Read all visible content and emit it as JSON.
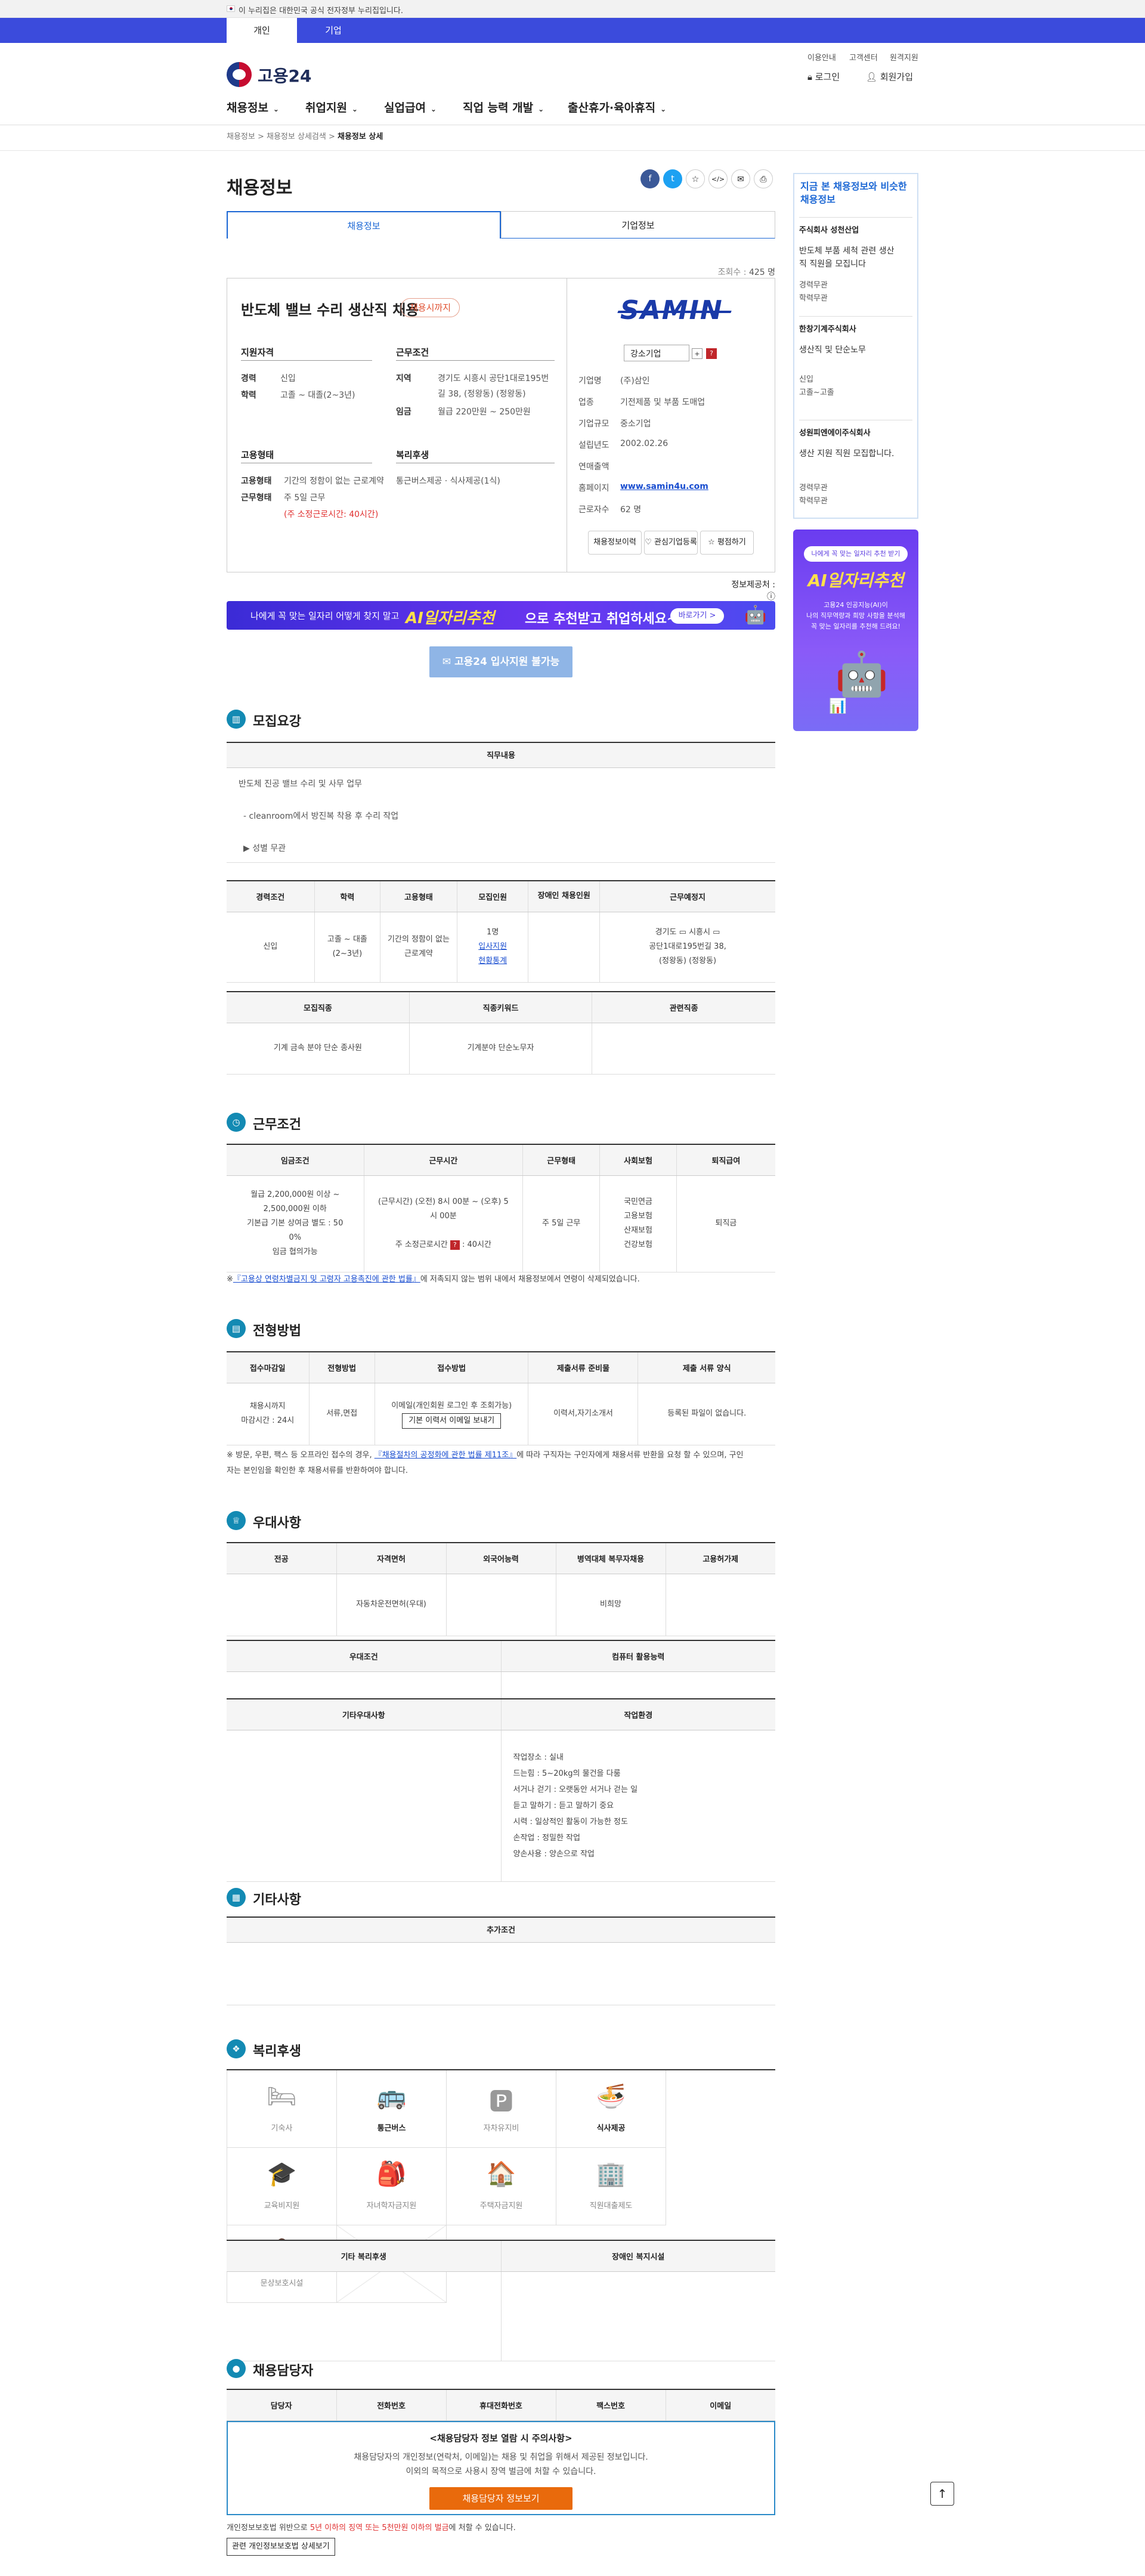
{
  "gov_banner": {
    "text": "이 누리집은 대한민국 공식 전자정부 누리집입니다."
  },
  "top_tabs": [
    "개인",
    "기업"
  ],
  "utility": [
    "이용안내",
    "고객센터",
    "원격지원"
  ],
  "logo": {
    "text": "고용24"
  },
  "auth": {
    "login": "로그인",
    "signup": "회원가입"
  },
  "gnb": [
    "채용정보",
    "취업지원",
    "실업급여",
    "직업 능력 개발",
    "출산휴가·육아휴직"
  ],
  "breadcrumb": {
    "items": [
      "채용정보",
      "채용정보 상세검색"
    ],
    "current": "채용정보 상세"
  },
  "page_title": "채용정보",
  "share": {
    "f": "f",
    "t": "t",
    "star": "☆",
    "code": "</>",
    "mail": "✉",
    "print": "⎙"
  },
  "content_tabs": [
    "채용정보",
    "기업정보"
  ],
  "views": {
    "label": "조회수 :",
    "value": "425 명"
  },
  "job": {
    "title": "반도체 밸브 수리 생산직 채용",
    "deadline": "채용시까지",
    "qual_head": "지원자격",
    "career_k": "경력",
    "career_v": "신입",
    "edu_k": "학력",
    "edu_v": "고졸 ~ 대졸(2~3년)",
    "cond_head": "근무조건",
    "region_k": "지역",
    "region_v1": "경기도 시흥시 공단1대로195번",
    "region_v2": "길 38, (정왕동) (정왕동)",
    "wage_k": "임금",
    "wage_v": "월급 220만원 ~ 250만원",
    "emp_head": "고용형태",
    "emptype_k": "고용형태",
    "emptype_v": "기간의 정함이 없는 근로계약",
    "worktype_k": "근무형태",
    "worktype_v": "주 5일 근무",
    "hours_v": "(주 소정근로시간: 40시간)",
    "welfare_head": "복리후생",
    "welfare_v": "통근버스제공 · 식사제공(1식)"
  },
  "company": {
    "logo": "SAMIN",
    "category": "강소기업",
    "plus": "+",
    "q": "?",
    "rows": [
      {
        "k": "기업명",
        "v": "(주)삼인"
      },
      {
        "k": "업종",
        "v": "기전제품 및 부품 도매업"
      },
      {
        "k": "기업규모",
        "v": "중소기업"
      },
      {
        "k": "설립년도",
        "v": "2002.02.26"
      },
      {
        "k": "연매출액",
        "v": ""
      },
      {
        "k": "홈페이지",
        "v": "www.samin4u.com"
      },
      {
        "k": "근로자수",
        "v": "62 명"
      }
    ],
    "buttons": [
      "채용정보이력",
      "관심기업등록",
      "평점하기"
    ]
  },
  "info_public": {
    "label": "정보제공처 :",
    "value": "ⓘ"
  },
  "ai_banner": {
    "t1": "나에게 꼭 맞는 일자리 어떻게 찾지 말고",
    "t2": "AI일자리추천",
    "t3": "으로 추천받고 취업하세요~",
    "btn": "바로가기 >"
  },
  "apply_btn": "고용24 입사지원 불가능",
  "sections": {
    "recruit": "모집요강",
    "condition": "근무조건",
    "selection": "전형방법",
    "preference": "우대사항",
    "etc": "기타사항",
    "welfare": "복리후생",
    "contact": "채용담당자"
  },
  "recruit": {
    "duty_head": "직무내용",
    "duty_lines": [
      "반도체 진공 밸브 수리 및 사무 업무",
      "- cleanroom에서 방진복 착용 후 수리 작업",
      "▶ 성별 무관"
    ],
    "table1_headers": [
      "경력조건",
      "학력",
      "고용형태",
      "모집인원",
      "장애인 채용인원",
      "근무예정지"
    ],
    "table1_row": {
      "career": "신입",
      "edu1": "고졸 ~ 대졸",
      "edu2": "(2~3년)",
      "emp1": "기간의 정함이 없는",
      "emp2": "근로계약",
      "count": "1명",
      "link1": "입사지원",
      "link2": "현황통계",
      "disabled": "",
      "loc1": "경기도",
      "loc2": "시흥시",
      "loc3": "공단1대로195번길 38,",
      "loc4": "(정왕동) (정왕동)"
    },
    "table2_headers": [
      "모집직종",
      "직종키워드",
      "관련직종"
    ],
    "table2_row": [
      "기계 금속 분야 단순 종사원",
      "기계분야 단순노무자",
      ""
    ]
  },
  "condition": {
    "headers": [
      "임금조건",
      "근무시간",
      "근무형태",
      "사회보험",
      "퇴직급여"
    ],
    "wage": [
      "월급 2,200,000원 이상 ~",
      "2,500,000원 이하",
      "기본급 기본 상여금 별도 : 50",
      "0%",
      "임금 협의가능"
    ],
    "time": [
      "(근무시간) (오전) 8시 00분 ~ (오후) 5",
      "시 00분",
      "주 소정근로시간",
      "40시간"
    ],
    "worktype": "주 5일 근무",
    "insurance": [
      "국민연금",
      "고용보험",
      "산재보험",
      "건강보험"
    ],
    "retire": "퇴직금",
    "note_pre": "※",
    "note_link": "『고용상 연령차별금지 및 고령자 고용촉진에 관한 법률』",
    "note_post": "에 저촉되지 않는 범위 내에서 채용정보에서 연령이 삭제되었습니다."
  },
  "selection": {
    "headers": [
      "접수마감일",
      "전형방법",
      "접수방법",
      "제출서류 준비물",
      "제출 서류 양식"
    ],
    "deadline1": "채용시까지",
    "deadline2": "마감시간 : 24시",
    "method": "서류,면접",
    "recv": "이메일(개인회원 로그인 후 조회가능)",
    "recv_btn": "기본 이력서 이메일 보내기",
    "docs": "이력서,자기소개서",
    "form": "등록된 파일이 없습니다.",
    "note_pre": "※ 방문, 우편, 팩스 등 오프라인 접수의 경우,",
    "note_link": "『채용절차의 공정화에 관한 법률 제11조』",
    "note_mid": "에 따라 구직자는 구인자에게 채용서류 반환을 요청 할 수 있으며, 구인",
    "note_2": "자는 본인임을 확인한 후 채용서류를 반환하여야 합니다."
  },
  "preference": {
    "headers": [
      "전공",
      "자격면허",
      "외국어능력",
      "병역대체 복무자채용",
      "고용허가제"
    ],
    "row": [
      "",
      "자동차운전면허(우대)",
      "",
      "비희망",
      ""
    ],
    "pref_head": "우대조건",
    "computer_head": "컴퓨터 활용능력",
    "other_head": "기타우대사항",
    "env_head": "작업환경",
    "env": [
      "작업장소 : 실내",
      "드는힘 : 5~20kg의 물건을 다룸",
      "서거나 걷기 : 오랫동안 서거나 걷는 일",
      "듣고 말하기 : 듣고 말하기 중요",
      "시력 : 일상적인 활동이 가능한 정도",
      "손작업 : 정밀한 작업",
      "양손사용 : 양손으로 작업"
    ]
  },
  "etc": {
    "head": "추가조건"
  },
  "welfare": {
    "items": [
      {
        "icon": "🛏",
        "label": "기숙사",
        "on": false,
        "name": "dormitory-icon"
      },
      {
        "icon": "🚌",
        "label": "통근버스",
        "on": true,
        "name": "bus-icon"
      },
      {
        "icon": "🅿",
        "label": "자차유지비",
        "on": false,
        "name": "car-icon"
      },
      {
        "icon": "🍜",
        "label": "식사제공",
        "on": true,
        "name": "meal-icon"
      },
      {
        "icon": "🎓",
        "label": "교육비지원",
        "on": false,
        "name": "education-icon"
      },
      {
        "icon": "🎒",
        "label": "자녀학자금지원",
        "on": false,
        "name": "child-education-icon"
      },
      {
        "icon": "🏠",
        "label": "주택자금지원",
        "on": false,
        "name": "housing-icon"
      },
      {
        "icon": "🏢",
        "label": "직원대출제도",
        "on": false,
        "name": "loan-icon"
      },
      {
        "icon": "👶",
        "label": "문상보호시설",
        "on": false,
        "name": "childcare-icon"
      },
      {
        "icon": "",
        "label": "",
        "on": false,
        "name": "empty-icon"
      }
    ],
    "other_head": "기타 복리후생",
    "disabled_head": "장애인 복지시설"
  },
  "contact": {
    "headers": [
      "담당자",
      "전화번호",
      "휴대전화번호",
      "팩스번호",
      "이메일"
    ],
    "notice_h": "<채용담당자 정보 열람 시 주의사항>",
    "notice_p1": "채용담당자의 개인정보(연락처, 이메일)는 채용 및 취업을 위해서 제공된 정보입니다.",
    "notice_p2": "이외의 목적으로 사용시 장역 벌금에 처할 수 있습니다.",
    "notice_btn": "채용담당자 정보보기",
    "law_pre": "개인정보보호법 위반으로",
    "law_red": "5년 이하의 징역 또는 5천만원 이하의 벌금",
    "law_post": "에 처할 수 있습니다.",
    "law_btn": "관련 개인정보보호법 상세보기"
  },
  "side": {
    "title1": "지금 본 채용정보와 비슷한",
    "title2": "채용정보",
    "cards": [
      {
        "company": "주식회사 성천산업",
        "l1": "반도체 부품 세척 관련 생산",
        "l2": "직 직원을 모집니다",
        "m1": "경력무관",
        "m2": "학력무관"
      },
      {
        "company": "한창기계주식회사",
        "l1": "생산직 및 단순노무",
        "l2": "",
        "m1": "신입",
        "m2": "고졸~고졸"
      },
      {
        "company": "성원피엔에이주식회사",
        "l1": "생산 지원 직원 모집합니다.",
        "l2": "",
        "m1": "경력무관",
        "m2": "학력무관"
      }
    ],
    "ai_pill": "나에게 꼭 맞는 일자리 추천 받기",
    "ai_title": "AI일자리추천",
    "ai_desc1": "고용24 인공지능(AI)이",
    "ai_desc2": "나의 직무역량과 희망 사항을 분석해",
    "ai_desc3": "꼭 맞는 일자리를 추천해 드려요!"
  },
  "top_btn": "↑",
  "colors": {
    "accent": "#3b4bdc",
    "section": "#138ab3",
    "link": "#1a4ed0",
    "warn": "#e96a0c"
  }
}
